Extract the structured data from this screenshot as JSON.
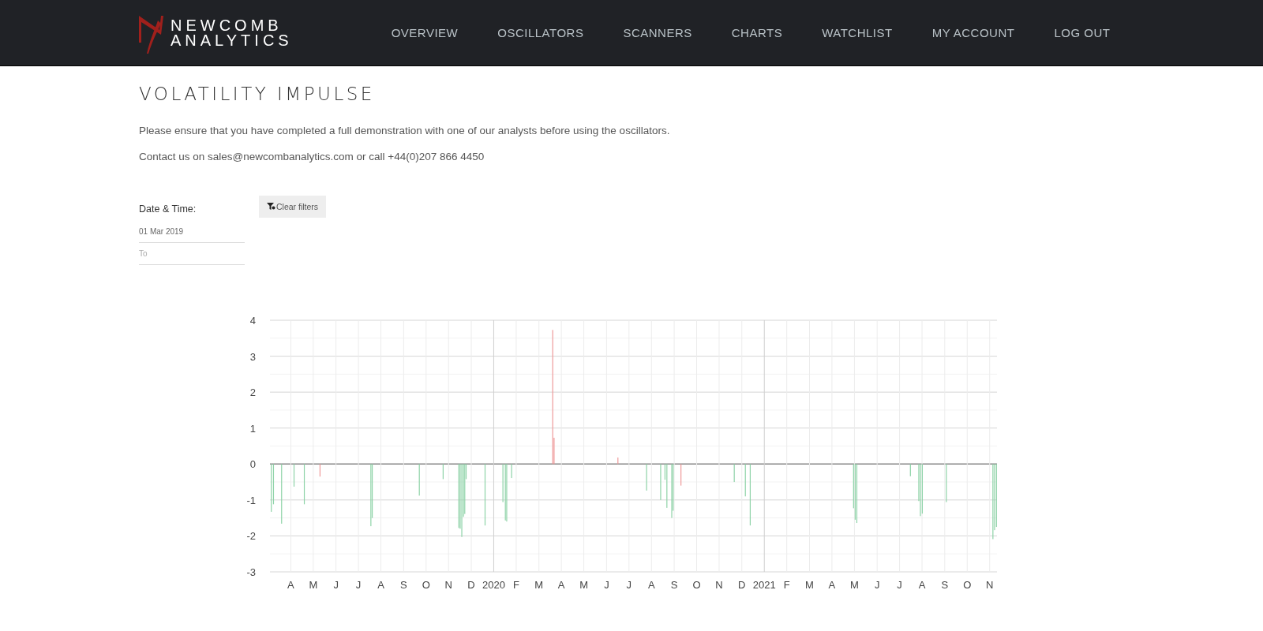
{
  "brand": {
    "line1": "NEWCOMB",
    "line2": "ANALYTICS"
  },
  "nav": [
    {
      "label": "OVERVIEW"
    },
    {
      "label": "OSCILLATORS"
    },
    {
      "label": "SCANNERS"
    },
    {
      "label": "CHARTS"
    },
    {
      "label": "WATCHLIST"
    },
    {
      "label": "MY ACCOUNT"
    },
    {
      "label": "LOG OUT"
    }
  ],
  "title": "VOLATILITY IMPULSE",
  "notice": "Please ensure that you have completed a full demonstration with one of our analysts before using the oscillators.",
  "contact": "Contact us on sales@newcombanalytics.com or call +44(0)207 866 4450",
  "filters": {
    "label": "Date & Time:",
    "from_value": "01 Mar 2019",
    "to_placeholder": "To",
    "clear_button": "Clear filters"
  },
  "chart_data": {
    "type": "bar",
    "x": [
      2019.178,
      2019.186,
      2019.216,
      2019.262,
      2019.3,
      2019.358,
      2019.546,
      2019.551,
      2019.725,
      2019.813,
      2019.871,
      2019.876,
      2019.882,
      2019.888,
      2019.893,
      2019.898,
      2019.968,
      2020.034,
      2020.043,
      2020.048,
      2020.066,
      2020.218,
      2020.223,
      2020.459,
      2020.565,
      2020.617,
      2020.633,
      2020.64,
      2020.658,
      2020.663,
      2020.692,
      2020.889,
      2020.93,
      2020.948,
      2021.33,
      2021.336,
      2021.342,
      2021.54,
      2021.571,
      2021.577,
      2021.584,
      2021.673,
      2021.845,
      2021.851,
      2021.858
    ],
    "series": [
      {
        "color": "#8fd3a8",
        "values": [
          -1.33,
          -1.12,
          -1.66,
          -0.63,
          -1.12,
          null,
          -1.73,
          -1.5,
          -0.88,
          -0.42,
          -1.78,
          -1.8,
          -2.03,
          -1.47,
          -1.39,
          -0.42,
          -1.71,
          -1.06,
          -1.57,
          -1.6,
          -0.39,
          null,
          null,
          null,
          -0.74,
          -1.0,
          -0.44,
          -1.22,
          -1.5,
          -1.3,
          null,
          -0.5,
          -0.9,
          -1.71,
          -1.23,
          -1.55,
          -1.64,
          -0.34,
          -1.03,
          -1.45,
          -1.38,
          -1.06,
          -2.09,
          -1.84,
          -1.75
        ]
      },
      {
        "color": "#ef9a9a",
        "values": [
          null,
          null,
          null,
          null,
          null,
          -0.35,
          null,
          null,
          null,
          null,
          null,
          null,
          null,
          null,
          null,
          null,
          null,
          null,
          null,
          null,
          null,
          3.73,
          0.73,
          0.18,
          null,
          null,
          null,
          null,
          null,
          null,
          -0.6,
          null,
          null,
          null,
          null,
          null,
          null,
          null,
          null,
          null,
          null,
          null,
          null,
          null,
          null
        ]
      }
    ],
    "grid": true,
    "xlim": [
      2019.173,
      2021.86
    ],
    "ylim": [
      -3,
      4
    ],
    "xticks": [
      {
        "value": 2019.25,
        "label": "A"
      },
      {
        "value": 2019.333,
        "label": "M"
      },
      {
        "value": 2019.417,
        "label": "J"
      },
      {
        "value": 2019.5,
        "label": "J"
      },
      {
        "value": 2019.583,
        "label": "A"
      },
      {
        "value": 2019.667,
        "label": "S"
      },
      {
        "value": 2019.75,
        "label": "O"
      },
      {
        "value": 2019.833,
        "label": "N"
      },
      {
        "value": 2019.917,
        "label": "D"
      },
      2020,
      {
        "value": 2020.083,
        "label": "F"
      },
      {
        "value": 2020.167,
        "label": "M"
      },
      {
        "value": 2020.25,
        "label": "A"
      },
      {
        "value": 2020.333,
        "label": "M"
      },
      {
        "value": 2020.417,
        "label": "J"
      },
      {
        "value": 2020.5,
        "label": "J"
      },
      {
        "value": 2020.583,
        "label": "A"
      },
      {
        "value": 2020.667,
        "label": "S"
      },
      {
        "value": 2020.75,
        "label": "O"
      },
      {
        "value": 2020.833,
        "label": "N"
      },
      {
        "value": 2020.917,
        "label": "D"
      },
      2021,
      {
        "value": 2021.083,
        "label": "F"
      },
      {
        "value": 2021.167,
        "label": "M"
      },
      {
        "value": 2021.25,
        "label": "A"
      },
      {
        "value": 2021.333,
        "label": "M"
      },
      {
        "value": 2021.417,
        "label": "J"
      },
      {
        "value": 2021.5,
        "label": "J"
      },
      {
        "value": 2021.583,
        "label": "A"
      },
      {
        "value": 2021.667,
        "label": "S"
      },
      {
        "value": 2021.75,
        "label": "O"
      },
      {
        "value": 2021.833,
        "label": "N"
      }
    ],
    "yticks": [
      -3,
      -2,
      -1,
      0,
      1,
      2,
      3,
      4
    ]
  }
}
